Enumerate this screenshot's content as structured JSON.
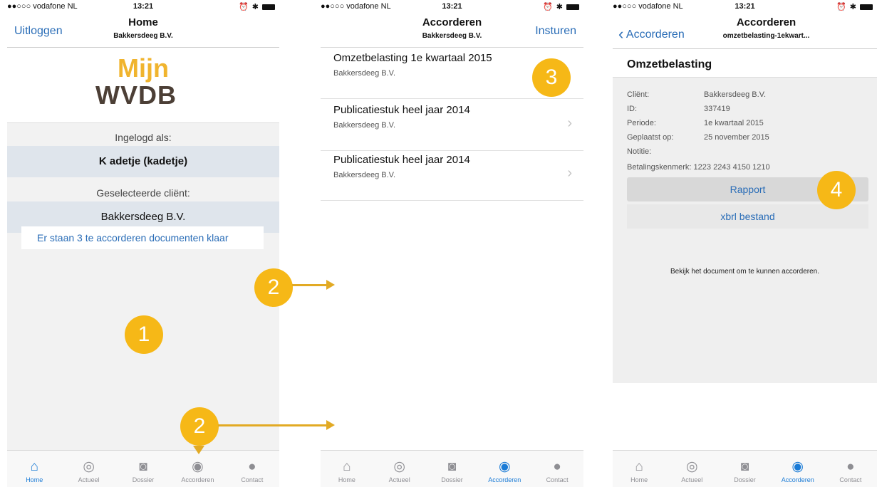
{
  "status": {
    "carrier": "●●○○○ vodafone NL",
    "wifi": "ᯤ",
    "time": "13:21",
    "icons": "⏰ ✱"
  },
  "tabs": [
    "Home",
    "Actueel",
    "Dossier",
    "Accorderen",
    "Contact"
  ],
  "tab_icons": {
    "home": "⌂",
    "actueel": "◎",
    "dossier": "◙",
    "accorderen": "◉",
    "contact": "●"
  },
  "phone1": {
    "nav_left": "Uitloggen",
    "title": "Home",
    "subtitle": "Bakkersdeeg B.V.",
    "logo": {
      "line1": "Mijn",
      "line2": "WVDB"
    },
    "logged_in_label": "Ingelogd als:",
    "user": "K adetje (kadetje)",
    "client_label": "Geselecteerde cliënt:",
    "client": "Bakkersdeeg B.V.",
    "notice": "Er staan 3 te accorderen documenten klaar"
  },
  "phone2": {
    "title": "Accorderen",
    "subtitle": "Bakkersdeeg B.V.",
    "nav_right": "Insturen",
    "items": [
      {
        "title": "Omzetbelasting 1e kwartaal 2015",
        "sub": "Bakkersdeeg B.V."
      },
      {
        "title": "Publicatiestuk heel jaar 2014",
        "sub": "Bakkersdeeg B.V."
      },
      {
        "title": "Publicatiestuk heel jaar 2014",
        "sub": "Bakkersdeeg B.V."
      }
    ]
  },
  "phone3": {
    "back": "Accorderen",
    "title": "Accorderen",
    "subtitle": "omzetbelasting-1ekwart...",
    "heading": "Omzetbelasting",
    "fields": [
      {
        "k": "Cliënt:",
        "v": "Bakkersdeeg B.V."
      },
      {
        "k": "ID:",
        "v": "337419"
      },
      {
        "k": "Periode:",
        "v": "1e kwartaal 2015"
      },
      {
        "k": "Geplaatst op:",
        "v": "25 november 2015"
      },
      {
        "k": "Notitie:",
        "v": ""
      }
    ],
    "betaling": "Betalingskenmerk: 1223 2243 4150 1210",
    "btn_rapport": "Rapport",
    "btn_xbrl": "xbrl bestand",
    "hint": "Bekijk het document om te kunnen accorderen."
  },
  "badges": {
    "b1": "1",
    "b2a": "2",
    "b2b": "2",
    "b3": "3",
    "b4": "4"
  },
  "colors": {
    "badge": "#f6b817",
    "arrow": "#e2aa24",
    "link": "#2a6db7",
    "tab_active": "#1a7bd6"
  }
}
